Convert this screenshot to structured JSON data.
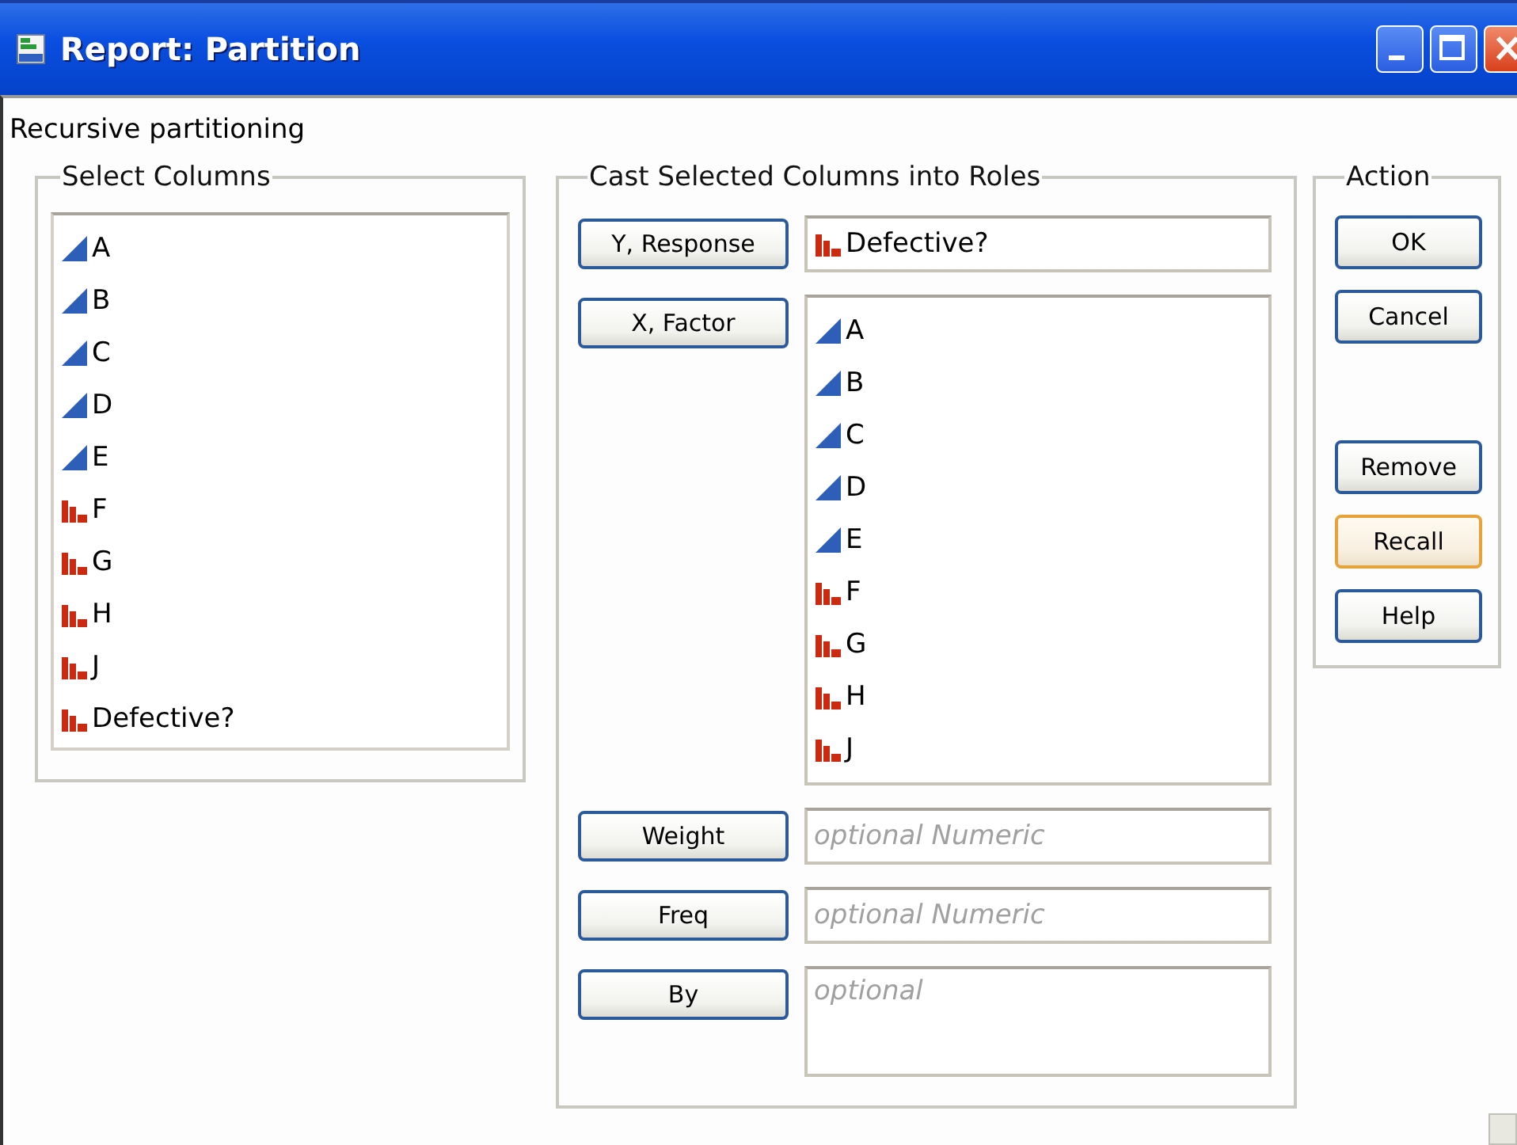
{
  "window": {
    "title": "Report: Partition"
  },
  "heading": "Recursive partitioning",
  "select_columns": {
    "title": "Select Columns",
    "items": [
      {
        "label": "A",
        "kind": "continuous"
      },
      {
        "label": "B",
        "kind": "continuous"
      },
      {
        "label": "C",
        "kind": "continuous"
      },
      {
        "label": "D",
        "kind": "continuous"
      },
      {
        "label": "E",
        "kind": "continuous"
      },
      {
        "label": "F",
        "kind": "nominal"
      },
      {
        "label": "G",
        "kind": "nominal"
      },
      {
        "label": "H",
        "kind": "nominal"
      },
      {
        "label": "J",
        "kind": "nominal"
      },
      {
        "label": "Defective?",
        "kind": "nominal"
      }
    ]
  },
  "roles": {
    "title": "Cast Selected Columns into Roles",
    "rows": [
      {
        "button": "Y, Response",
        "kind": "single",
        "items": [
          {
            "label": "Defective?",
            "kind": "nominal"
          }
        ]
      },
      {
        "button": "X, Factor",
        "kind": "list",
        "items": [
          {
            "label": "A",
            "kind": "continuous"
          },
          {
            "label": "B",
            "kind": "continuous"
          },
          {
            "label": "C",
            "kind": "continuous"
          },
          {
            "label": "D",
            "kind": "continuous"
          },
          {
            "label": "E",
            "kind": "continuous"
          },
          {
            "label": "F",
            "kind": "nominal"
          },
          {
            "label": "G",
            "kind": "nominal"
          },
          {
            "label": "H",
            "kind": "nominal"
          },
          {
            "label": "J",
            "kind": "nominal"
          }
        ]
      },
      {
        "button": "Weight",
        "kind": "single",
        "placeholder": "optional Numeric"
      },
      {
        "button": "Freq",
        "kind": "single",
        "placeholder": "optional Numeric"
      },
      {
        "button": "By",
        "kind": "multi",
        "placeholder": "optional"
      }
    ]
  },
  "action": {
    "title": "Action",
    "button_groups": [
      [
        {
          "label": "OK",
          "focused": false
        },
        {
          "label": "Cancel",
          "focused": false
        }
      ],
      [
        {
          "label": "Remove",
          "focused": false
        },
        {
          "label": "Recall",
          "focused": true
        },
        {
          "label": "Help",
          "focused": false
        }
      ]
    ]
  }
}
